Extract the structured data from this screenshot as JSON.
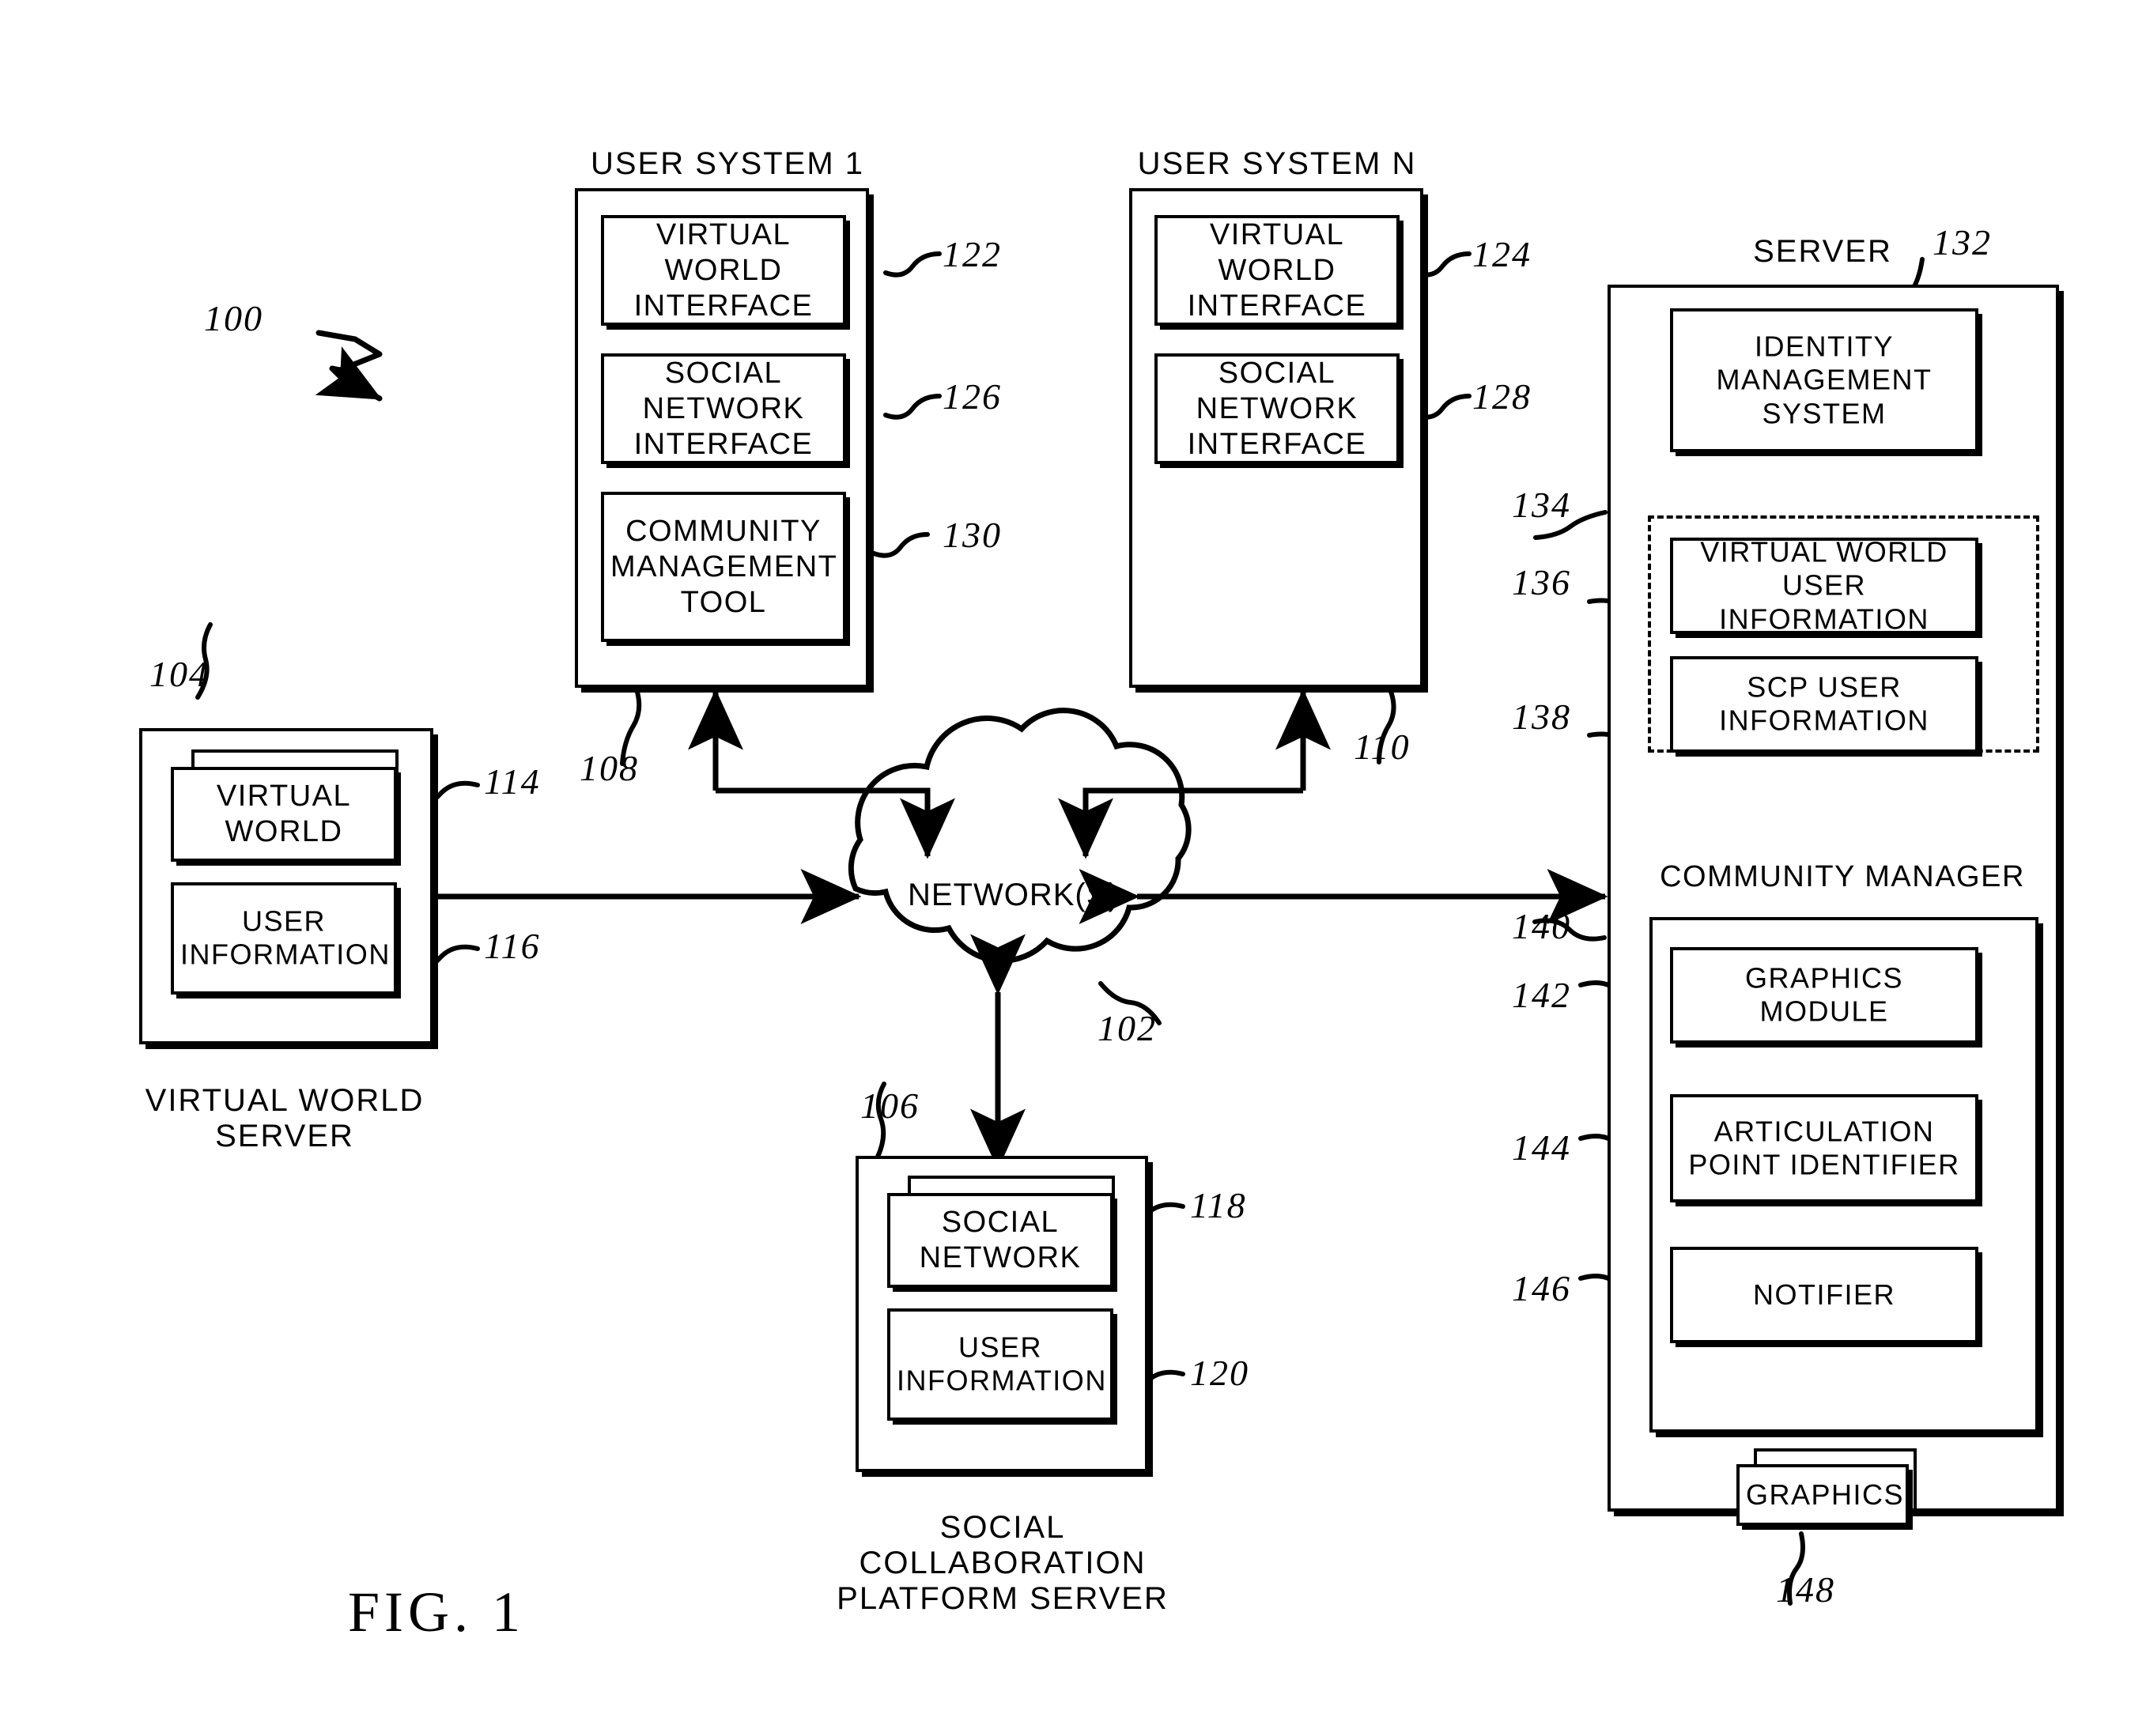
{
  "figure": {
    "label": "FIG. 1",
    "system_ref": "100"
  },
  "user_system_1": {
    "title": "USER SYSTEM 1",
    "ref": "108",
    "modules": [
      {
        "label": "VIRTUAL WORLD\nINTERFACE",
        "ref": "122"
      },
      {
        "label": "SOCIAL NETWORK\nINTERFACE",
        "ref": "126"
      },
      {
        "label": "COMMUNITY\nMANAGEMENT\nTOOL",
        "ref": "130"
      }
    ]
  },
  "user_system_n": {
    "title": "USER SYSTEM N",
    "ref": "110",
    "modules": [
      {
        "label": "VIRTUAL WORLD\nINTERFACE",
        "ref": "124"
      },
      {
        "label": "SOCIAL NETWORK\nINTERFACE",
        "ref": "128"
      }
    ]
  },
  "network": {
    "label": "NETWORK(S)",
    "ref": "102"
  },
  "virtual_world_server": {
    "caption": "VIRTUAL WORLD\nSERVER",
    "ref": "104",
    "modules": [
      {
        "label": "VIRTUAL\nWORLD",
        "ref": "114",
        "stacked": true
      },
      {
        "label": "USER\nINFORMATION",
        "ref": "116",
        "stacked": false
      }
    ]
  },
  "social_collaboration_server": {
    "caption": "SOCIAL COLLABORATION\nPLATFORM SERVER",
    "ref": "106",
    "modules": [
      {
        "label": "SOCIAL\nNETWORK",
        "ref": "118",
        "stacked": true
      },
      {
        "label": "USER\nINFORMATION",
        "ref": "120",
        "stacked": false
      }
    ]
  },
  "server": {
    "title": "SERVER",
    "identity_management_system": {
      "label": "IDENTITY\nMANAGEMENT\nSYSTEM",
      "ref": "132"
    },
    "user_info_group": {
      "ref": "134",
      "modules": [
        {
          "label": "VIRTUAL WORLD\nUSER INFORMATION",
          "ref": "136"
        },
        {
          "label": "SCP USER\nINFORMATION",
          "ref": "138"
        }
      ]
    },
    "community_manager": {
      "title": "COMMUNITY MANAGER",
      "ref": "140",
      "modules": [
        {
          "label": "GRAPHICS MODULE",
          "ref": "142"
        },
        {
          "label": "ARTICULATION\nPOINT IDENTIFIER",
          "ref": "144"
        },
        {
          "label": "NOTIFIER",
          "ref": "146"
        }
      ]
    },
    "graphics": {
      "label": "GRAPHICS",
      "ref": "148"
    }
  },
  "colors": {
    "ink": "#000000",
    "paper": "#ffffff"
  }
}
